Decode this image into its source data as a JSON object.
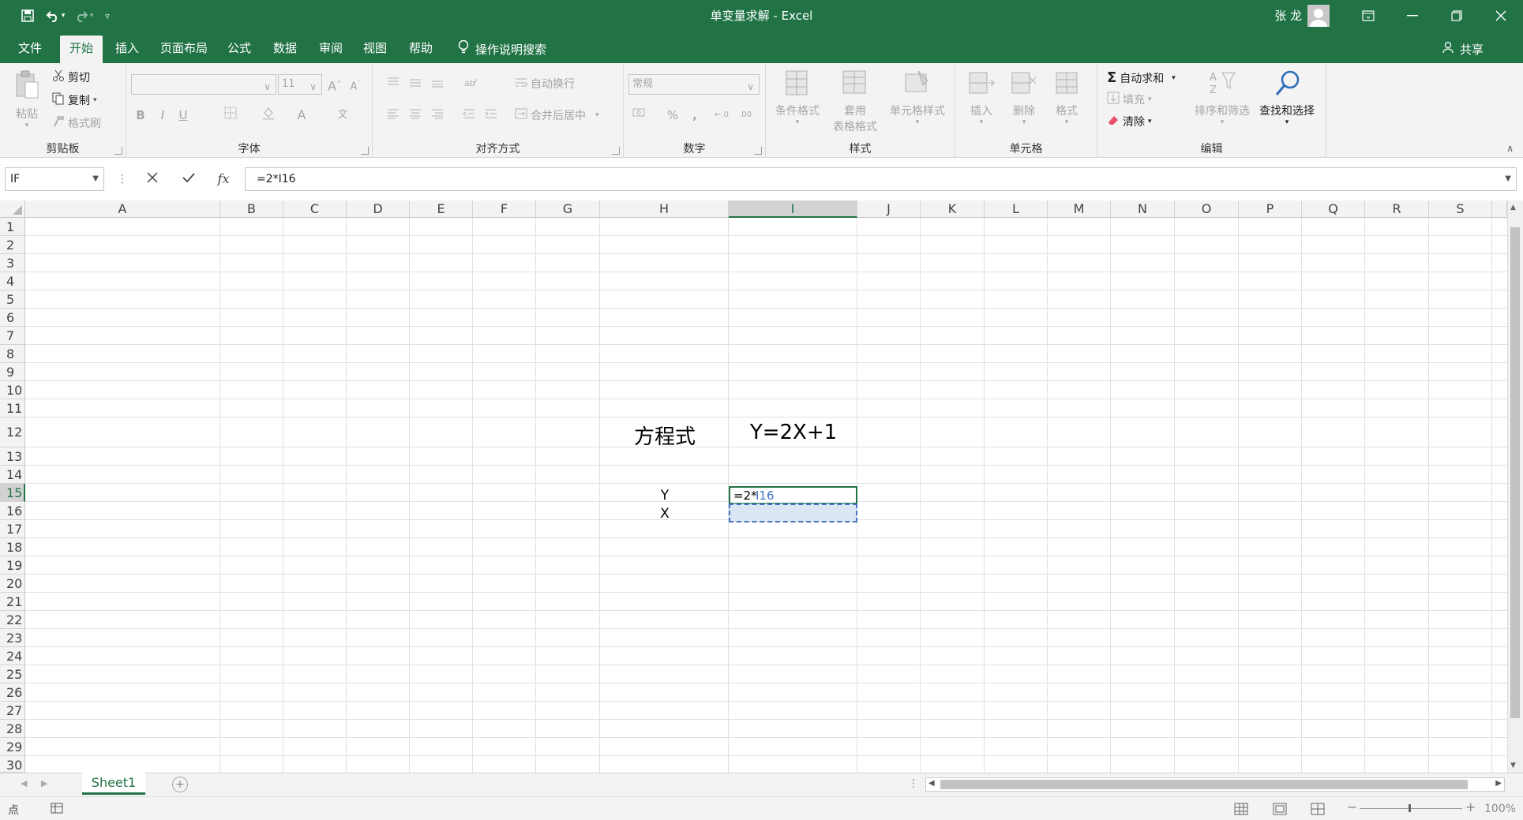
{
  "window": {
    "title": "单变量求解 - Excel",
    "user": "张 龙"
  },
  "tabs": [
    "文件",
    "开始",
    "插入",
    "页面布局",
    "公式",
    "数据",
    "审阅",
    "视图",
    "帮助"
  ],
  "active_tab": "开始",
  "tellme": "操作说明搜索",
  "share": "共享",
  "ribbon": {
    "clipboard": {
      "paste": "粘贴",
      "cut": "剪切",
      "copy": "复制",
      "painter": "格式刷",
      "label": "剪贴板"
    },
    "font": {
      "size": "11",
      "label": "字体",
      "bold": "B",
      "italic": "I",
      "underline": "U",
      "grow": "A",
      "shrink": "A",
      "color": "A",
      "phonetic": "文"
    },
    "alignment": {
      "wrap": "自动换行",
      "merge": "合并后居中",
      "label": "对齐方式"
    },
    "number": {
      "format": "常规",
      "percent": "%",
      "comma": ",",
      "inc_dec": "←.0",
      "dec_dec": ".00",
      "label": "数字"
    },
    "styles": {
      "conditional": "条件格式",
      "table1": "套用",
      "table2": "表格格式",
      "cell": "单元格样式",
      "label": "样式"
    },
    "cells": {
      "insert": "插入",
      "delete": "删除",
      "format": "格式",
      "label": "单元格"
    },
    "editing": {
      "autosum": "自动求和",
      "fill": "填充",
      "clear": "清除",
      "sort": "排序和筛选",
      "find": "查找和选择",
      "label": "编辑"
    }
  },
  "formula_bar": {
    "name_box": "IF",
    "fx": "fx",
    "formula": "=2*I16"
  },
  "grid": {
    "columns": [
      "A",
      "B",
      "C",
      "D",
      "E",
      "F",
      "G",
      "H",
      "I",
      "J",
      "K",
      "L",
      "M",
      "N",
      "O",
      "P",
      "Q",
      "R",
      "S"
    ],
    "rows": [
      "1",
      "2",
      "3",
      "4",
      "5",
      "6",
      "7",
      "8",
      "9",
      "10",
      "11",
      "12",
      "13",
      "14",
      "15",
      "16",
      "17",
      "18",
      "19",
      "20",
      "21",
      "22",
      "23",
      "24",
      "25",
      "26",
      "27",
      "28",
      "29",
      "30"
    ],
    "cells": {
      "H12": "方程式",
      "I12": "Y=2X+1",
      "H15": "Y",
      "H16": "X",
      "I15_prefix": "=2*",
      "I15_ref": "I16"
    }
  },
  "sheets": [
    "Sheet1"
  ],
  "status": {
    "mode": "点",
    "zoom": "100%"
  },
  "colors": {
    "brand": "#217346",
    "ref_blue": "#4472c4"
  }
}
